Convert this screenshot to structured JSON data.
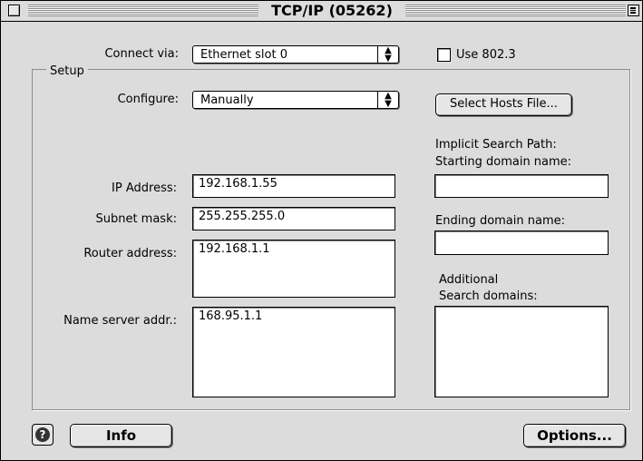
{
  "window": {
    "title": "TCP/IP (05262)"
  },
  "connect": {
    "label": "Connect via:",
    "value": "Ethernet slot 0"
  },
  "use8023": {
    "label": "Use 802.3",
    "checked": false
  },
  "setup": {
    "group_title": "Setup"
  },
  "configure": {
    "label": "Configure:",
    "value": "Manually"
  },
  "select_hosts_button": "Select Hosts File...",
  "search_path": {
    "heading1": "Implicit Search Path:",
    "heading2": "Starting domain name:",
    "starting_value": "",
    "ending_label": "Ending domain name:",
    "ending_value": "",
    "additional_label1": "Additional",
    "additional_label2": "Search domains:",
    "additional_value": ""
  },
  "ip": {
    "label": "IP Address:",
    "value": "192.168.1.55"
  },
  "subnet": {
    "label": "Subnet mask:",
    "value": "255.255.255.0"
  },
  "router": {
    "label": "Router address:",
    "value": "192.168.1.1"
  },
  "nameserver": {
    "label": "Name server addr.:",
    "value": "168.95.1.1"
  },
  "buttons": {
    "help": "?",
    "info": "Info",
    "options": "Options..."
  },
  "icons": {
    "help": "help-icon",
    "popup_arrows": "up-down-arrows-icon",
    "close": "close-box-icon",
    "zoom": "window-shade-icon"
  }
}
